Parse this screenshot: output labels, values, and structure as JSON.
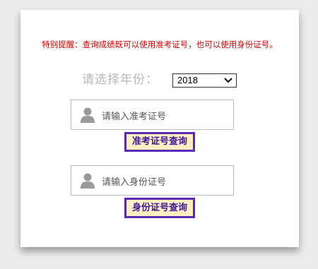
{
  "notice": "特别提醒：查询成绩既可以使用准考证号，也可以使用身份证号。",
  "year": {
    "label": "请选择年份：",
    "selected": "2018"
  },
  "exam_number": {
    "placeholder": "请输入准考证号",
    "button": "准考证号查询"
  },
  "id_number": {
    "placeholder": "请输入身份证号",
    "button": "身份证号查询"
  },
  "colors": {
    "notice": "#d60000",
    "button_bg": "#fdefc2",
    "button_border": "#5a2bb0",
    "label_gray": "#b8b8b8"
  },
  "icons": [
    "user-icon",
    "chevron-down-icon"
  ]
}
